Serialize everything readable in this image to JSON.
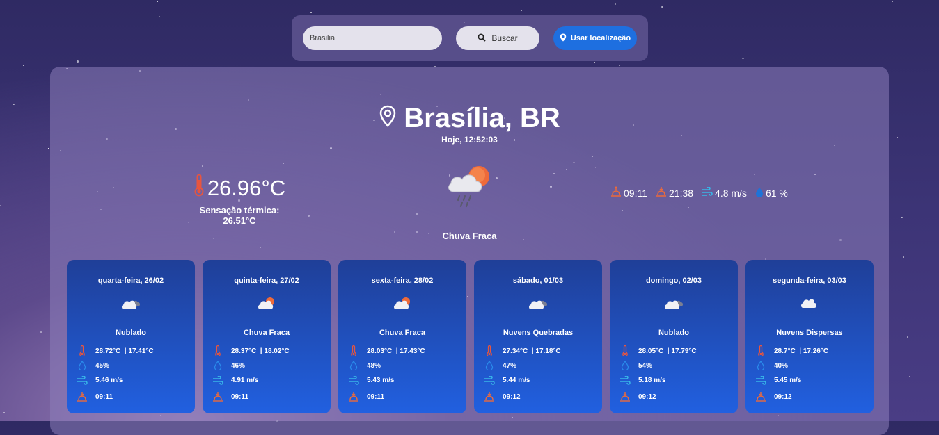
{
  "search": {
    "value": "Brasilia",
    "button_label": "Buscar",
    "location_button_label": "Usar localização"
  },
  "current": {
    "city": "Brasília, BR",
    "datetime": "Hoje, 12:52:03",
    "temperature": "26.96°C",
    "feels_like": "Sensação térmica: 26.51°C",
    "condition": "Chuva Fraca",
    "sunrise": "09:11",
    "sunset": "21:38",
    "wind": "4.8 m/s",
    "humidity": "61 %"
  },
  "forecast": [
    {
      "date": "quarta-feira, 26/02",
      "condition": "Nublado",
      "temps": "28.72°C  | 17.41°C",
      "humidity": "45%",
      "wind": "5.46 m/s",
      "sunrise": "09:11",
      "icon": "clouds-icon"
    },
    {
      "date": "quinta-feira, 27/02",
      "condition": "Chuva Fraca",
      "temps": "28.37°C  | 18.02°C",
      "humidity": "46%",
      "wind": "4.91 m/s",
      "sunrise": "09:11",
      "icon": "sun-cloud-icon"
    },
    {
      "date": "sexta-feira, 28/02",
      "condition": "Chuva Fraca",
      "temps": "28.03°C  | 17.43°C",
      "humidity": "48%",
      "wind": "5.43 m/s",
      "sunrise": "09:11",
      "icon": "sun-cloud-icon"
    },
    {
      "date": "sábado, 01/03",
      "condition": "Nuvens Quebradas",
      "temps": "27.34°C  | 17.18°C",
      "humidity": "47%",
      "wind": "5.44 m/s",
      "sunrise": "09:12",
      "icon": "clouds-icon"
    },
    {
      "date": "domingo, 02/03",
      "condition": "Nublado",
      "temps": "28.05°C  | 17.79°C",
      "humidity": "54%",
      "wind": "5.18 m/s",
      "sunrise": "09:12",
      "icon": "clouds-icon"
    },
    {
      "date": "segunda-feira, 03/03",
      "condition": "Nuvens Dispersas",
      "temps": "28.7°C  | 17.26°C",
      "humidity": "40%",
      "wind": "5.45 m/s",
      "sunrise": "09:12",
      "icon": "cloud-icon"
    }
  ],
  "colors": {
    "accent": "#1e6fe0",
    "thermo": "#e8553e",
    "sun": "#ee6a3a",
    "wind": "#38b6e8",
    "drop": "#1e73d8"
  }
}
